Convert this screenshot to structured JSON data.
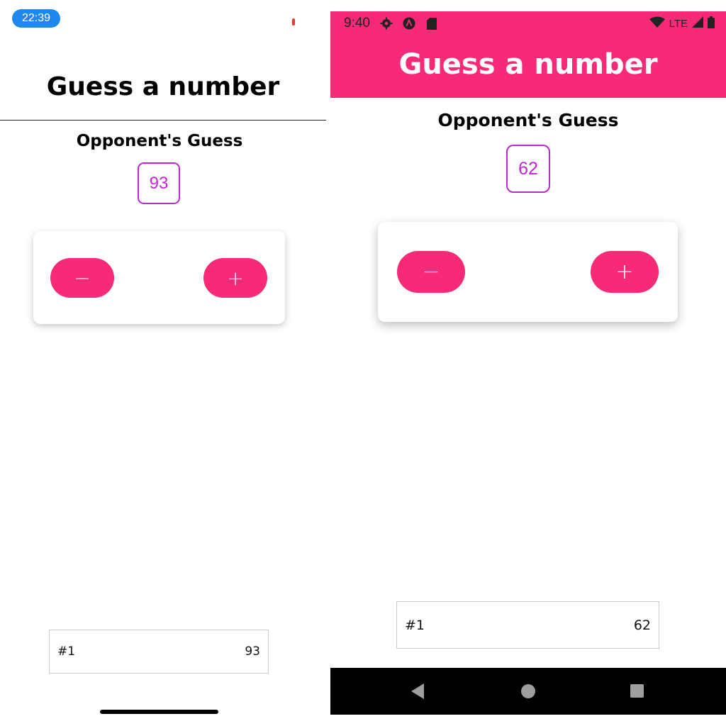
{
  "ios": {
    "status_time": "22:39",
    "header_title": "Guess a number",
    "subtitle": "Opponent's Guess",
    "current_guess": "93",
    "buttons": {
      "minus_label": "−",
      "plus_label": "+"
    },
    "log": [
      {
        "round": "#1",
        "guess": "93"
      }
    ]
  },
  "android": {
    "status_time": "9:40",
    "status_network": "LTE",
    "header_title": "Guess a number",
    "subtitle": "Opponent's Guess",
    "current_guess": "62",
    "buttons": {
      "minus_label": "−",
      "plus_label": "+"
    },
    "log": [
      {
        "round": "#1",
        "guess": "62"
      }
    ]
  },
  "colors": {
    "accent": "#f72a78",
    "number_border": "#c026d3",
    "ios_time_pill": "#1e88ee"
  },
  "icons": {
    "android_status_left": [
      "gear-icon",
      "app-icon",
      "sd-card-icon"
    ],
    "android_status_right": [
      "wifi-icon",
      "signal-icon",
      "battery-icon"
    ],
    "android_nav": [
      "back-icon",
      "home-icon",
      "recents-icon"
    ]
  }
}
